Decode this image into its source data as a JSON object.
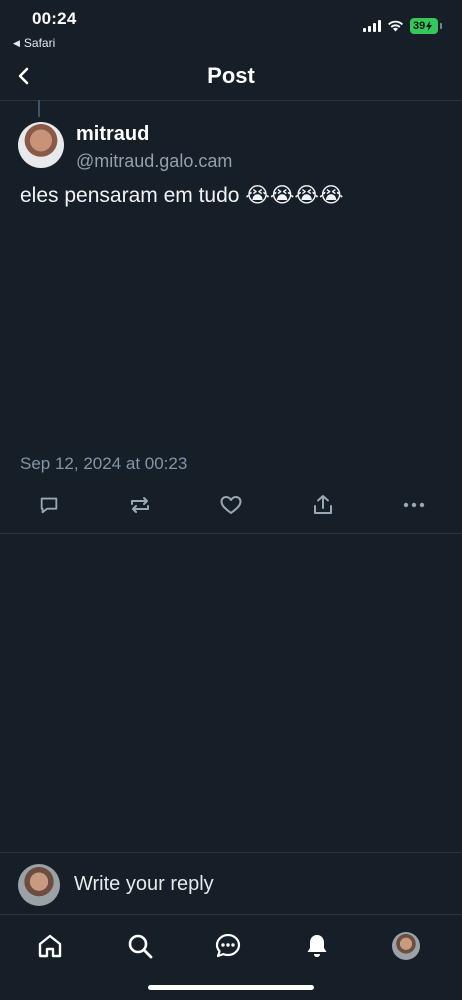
{
  "status_bar": {
    "time": "00:24",
    "back_app": "Safari",
    "battery": "39"
  },
  "header": {
    "title": "Post"
  },
  "post": {
    "display_name": "mitraud",
    "handle": "@mitraud.galo.cam",
    "text": "eles pensaram em tudo 😭😭😭😭",
    "timestamp": "Sep 12, 2024 at 00:23"
  },
  "reply": {
    "placeholder": "Write your reply"
  },
  "colors": {
    "background": "#161e27",
    "muted_text": "#93a0ad",
    "icon": "#9aa8b6",
    "divider": "#2a3540",
    "battery": "#34c759"
  },
  "icons": {
    "actions": [
      "reply-icon",
      "repost-icon",
      "like-icon",
      "share-icon",
      "more-icon"
    ],
    "tabs": [
      "home-icon",
      "search-icon",
      "chat-icon",
      "notifications-icon",
      "profile-avatar"
    ]
  }
}
